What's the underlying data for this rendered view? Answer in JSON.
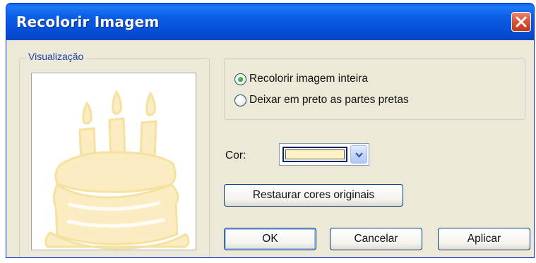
{
  "dialog": {
    "title": "Recolorir Imagem",
    "close_icon": "close-icon"
  },
  "preview": {
    "legend": "Visualização",
    "image": "cake-with-candles",
    "tint_color": "#f8e7a8"
  },
  "options": {
    "items": [
      {
        "label": "Recolorir imagem inteira",
        "checked": true
      },
      {
        "label": "Deixar em preto as partes pretas",
        "checked": false
      }
    ]
  },
  "color": {
    "label": "Cor:",
    "selected": "#fff3c5",
    "dropdown_icon": "chevron-down-icon"
  },
  "buttons": {
    "restore": "Restaurar cores originais",
    "ok": "OK",
    "cancel": "Cancelar",
    "apply": "Aplicar"
  },
  "colors": {
    "titlebar": "#0650d8",
    "dialog_bg": "#ece9d8",
    "close_button": "#d4502f",
    "radio_checked": "#21a121"
  }
}
